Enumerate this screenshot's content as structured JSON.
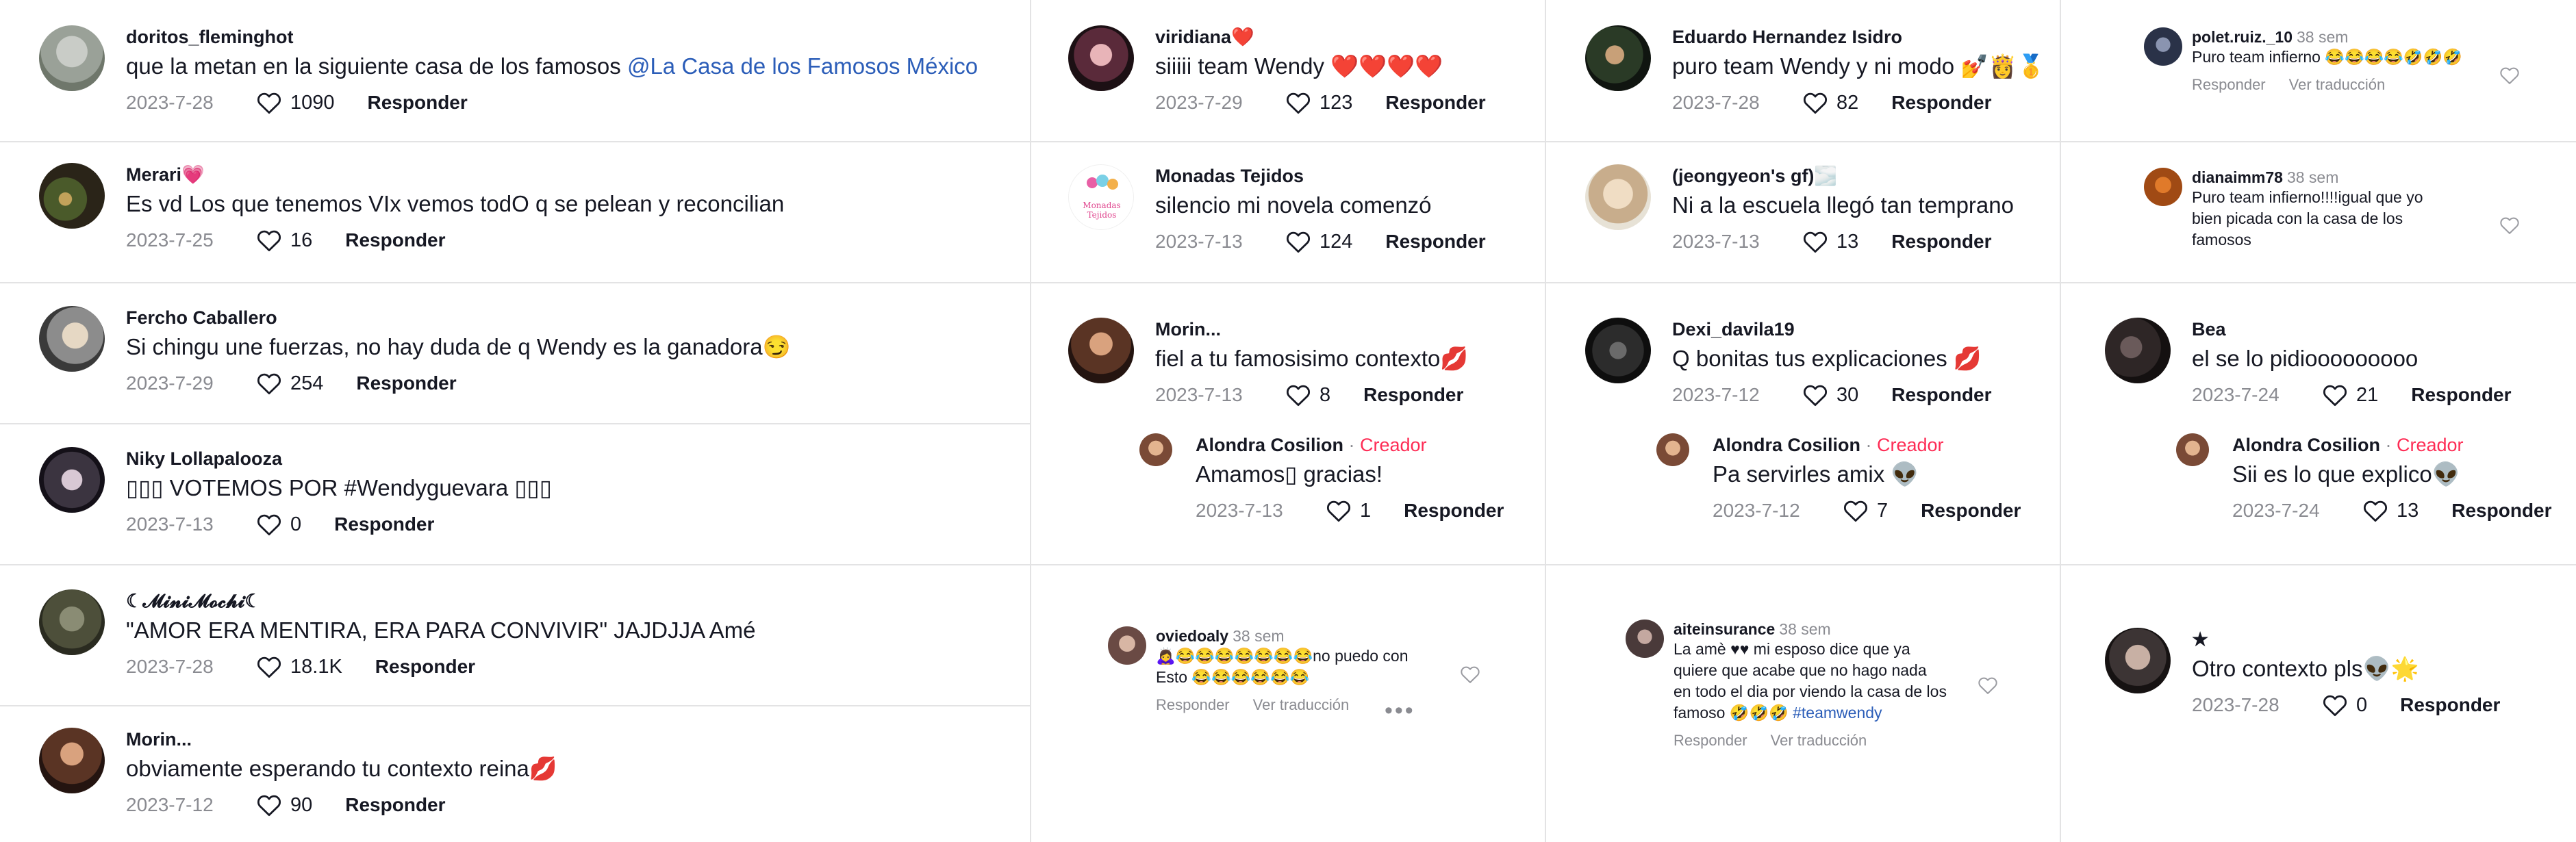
{
  "colors": {
    "creator": "#fe2c55",
    "mention": "#2b5db8",
    "muted": "#8a8b91",
    "divider": "#e3e3e4"
  },
  "icons": {
    "like": "heart-outline-icon",
    "more": "ellipsis-icon"
  },
  "col1": [
    {
      "user": "doritos_fleminghot",
      "text": "que la metan en la siguiente casa de los famosos ",
      "mention": "@La  Casa  de  los  Famosos  México",
      "date": "2023-7-28",
      "likes": "1090",
      "reply": "Responder"
    },
    {
      "user": "Merari💗",
      "text": "Es vd Los que tenemos VIx vemos todO q se pelean y reconcilian",
      "date": "2023-7-25",
      "likes": "16",
      "reply": "Responder"
    },
    {
      "user": "Fercho Caballero",
      "text": "Si chingu une fuerzas, no hay duda de q Wendy es la ganadora😏",
      "date": "2023-7-29",
      "likes": "254",
      "reply": "Responder"
    },
    {
      "user": "Niky Lollapalooza",
      "text": "▯▯▯ VOTEMOS POR #Wendyguevara ▯▯▯",
      "date": "2023-7-13",
      "likes": "0",
      "reply": "Responder"
    },
    {
      "user": "☾𝓜𝓲𝓷𝓲𝓜𝓸𝓬𝓱𝓲☾",
      "text": "\"AMOR ERA MENTIRA, ERA PARA CONVIVIR\" JAJDJJA Amé",
      "date": "2023-7-28",
      "likes": "18.1K",
      "reply": "Responder"
    },
    {
      "user": "Morin...",
      "text": "obviamente esperando tu contexto reina💋",
      "date": "2023-7-12",
      "likes": "90",
      "reply": "Responder"
    }
  ],
  "col2": [
    {
      "user": "viridiana❤️",
      "text": "siiiii team Wendy ❤️❤️❤️❤️",
      "date": "2023-7-29",
      "likes": "123",
      "reply": "Responder"
    },
    {
      "user": "Monadas Tejidos",
      "text": "silencio mi novela comenzó",
      "date": "2023-7-13",
      "likes": "124",
      "reply": "Responder",
      "avatar_text": "Monadas Tejidos"
    },
    {
      "user": "Morin...",
      "text": "fiel a tu famosisimo contexto💋",
      "date": "2023-7-13",
      "likes": "8",
      "reply": "Responder",
      "sub": {
        "user": "Alondra Cosilion",
        "sep": " · ",
        "role": "Creador",
        "text": "Amamos▯ gracias!",
        "date": "2023-7-13",
        "likes": "1",
        "reply": "Responder"
      }
    },
    {
      "user": "oviedoaly",
      "weeks": "38 sem",
      "text": "🙇‍♀️😂😂😂😂😂😂😂no puedo con Esto 😂😂😂😂😂😂",
      "reply": "Responder",
      "translate": "Ver traducción"
    }
  ],
  "col3": [
    {
      "user": "Eduardo Hernandez Isidro",
      "text": "puro team Wendy y ni modo 💅👸🥇",
      "date": "2023-7-28",
      "likes": "82",
      "reply": "Responder"
    },
    {
      "user": "(jeongyeon's gf)🌫️",
      "text": "Ni a la escuela llegó tan temprano",
      "date": "2023-7-13",
      "likes": "13",
      "reply": "Responder"
    },
    {
      "user": "Dexi_davila19",
      "text": "Q bonitas tus explicaciones 💋",
      "date": "2023-7-12",
      "likes": "30",
      "reply": "Responder",
      "sub": {
        "user": "Alondra Cosilion",
        "sep": " · ",
        "role": "Creador",
        "text": "Pa servirles amix 👽",
        "date": "2023-7-12",
        "likes": "7",
        "reply": "Responder"
      }
    },
    {
      "user": "aiteinsurance",
      "weeks": "38 sem",
      "text": "La amè ♥♥ mi esposo dice que ya quiere que acabe que no hago nada en todo el dia por viendo la casa de los famoso 🤣🤣🤣 ",
      "hashtag": "#teamwendy",
      "reply": "Responder",
      "translate": "Ver traducción"
    }
  ],
  "col4": [
    {
      "user": "polet.ruiz._10",
      "weeks": "38 sem",
      "text": "Puro team infierno 😂😂😂😂🤣🤣🤣",
      "reply": "Responder",
      "translate": "Ver traducción"
    },
    {
      "user": "dianaimm78",
      "weeks": "38 sem",
      "text": "Puro team infierno!!!!igual que yo bien picada con la casa de los famosos"
    },
    {
      "user": "Bea",
      "text": "el se lo pidiooooooooo",
      "date": "2023-7-24",
      "likes": "21",
      "reply": "Responder",
      "sub": {
        "user": "Alondra Cosilion",
        "sep": " · ",
        "role": "Creador",
        "text": "Sii es lo que explico👽",
        "date": "2023-7-24",
        "likes": "13",
        "reply": "Responder"
      }
    },
    {
      "user": "★",
      "text": "Otro contexto pls👽🌟",
      "date": "2023-7-28",
      "likes": "0",
      "reply": "Responder"
    }
  ]
}
